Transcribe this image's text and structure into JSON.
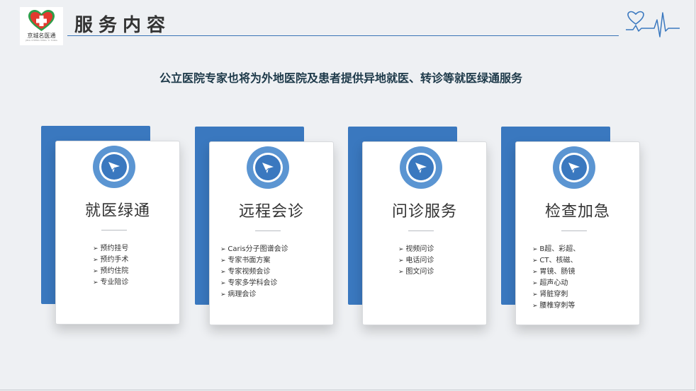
{
  "header": {
    "logo_text": "京城名医通",
    "logo_sub": "JING CHENG MING YI TONG",
    "title": "服务内容"
  },
  "subtitle": "公立医院专家也将为外地医院及患者提供异地就医、转诊等就医绿通服务",
  "cards": [
    {
      "title": "就医绿通",
      "items": [
        "预约挂号",
        "预约手术",
        "预约住院",
        "专业陪诊"
      ]
    },
    {
      "title": "远程会诊",
      "items": [
        "Caris分子图谱会诊",
        "专家书面方案",
        "专家视频会诊",
        "专家多学科会诊",
        "病理会诊"
      ]
    },
    {
      "title": "问诊服务",
      "items": [
        "视频问诊",
        "电话问诊",
        "图文问诊"
      ]
    },
    {
      "title": "检查加急",
      "items": [
        "B超、彩超、",
        "CT、核磁、",
        "胃镜、肠镜",
        "超声心动",
        "肾脏穿刺",
        "腰椎穿刺等"
      ]
    }
  ],
  "icons": {
    "badge": "paper-plane-icon",
    "heartbeat": "heart-pulse-icon"
  },
  "colors": {
    "accent": "#3a78bf",
    "badge_ring": "#5b95d2",
    "background": "#eef0f3"
  }
}
